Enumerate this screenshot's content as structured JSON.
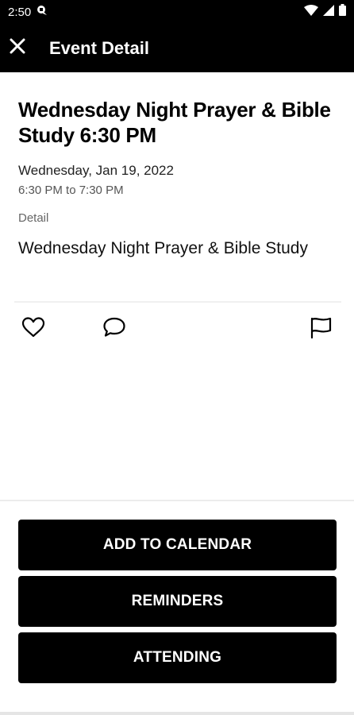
{
  "status_bar": {
    "time": "2:50"
  },
  "app_bar": {
    "title": "Event Detail"
  },
  "event": {
    "title": "Wednesday Night Prayer & Bible Study 6:30 PM",
    "date": "Wednesday, Jan 19, 2022",
    "time_range": "6:30 PM to 7:30 PM",
    "detail_label": "Detail",
    "detail_text": "Wednesday Night Prayer & Bible Study"
  },
  "buttons": {
    "add_to_calendar": "ADD TO CALENDAR",
    "reminders": "REMINDERS",
    "attending": "ATTENDING"
  },
  "icons": {
    "close": "close-icon",
    "like": "heart-icon",
    "comment": "comment-icon",
    "report": "flag-icon"
  }
}
